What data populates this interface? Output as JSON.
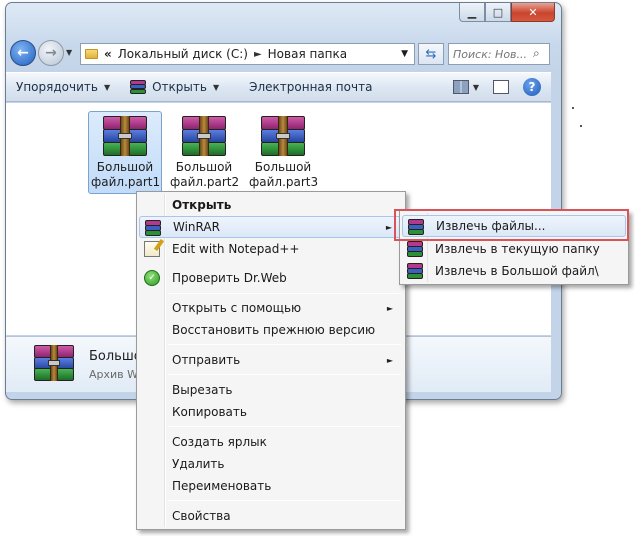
{
  "window": {
    "controls": {
      "minimize": "▁",
      "maximize": "□",
      "close": "✕"
    }
  },
  "address": {
    "prefix": "«",
    "crumbs": [
      "Локальный диск (C:)",
      "Новая папка"
    ],
    "separator": "►",
    "dropdown": "▼"
  },
  "search": {
    "placeholder": "Поиск: Нов..."
  },
  "toolbar": {
    "organize": "Упорядочить",
    "open": "Открыть",
    "email": "Электронная почта"
  },
  "files": [
    {
      "line1": "Большой",
      "line2": "файл.part1"
    },
    {
      "line1": "Большой",
      "line2": "файл.part2"
    },
    {
      "line1": "Большой",
      "line2": "файл.part3"
    }
  ],
  "status": {
    "name": "Большой",
    "type": "Архив W"
  },
  "context_menu": {
    "items": [
      "Открыть",
      "WinRAR",
      "Edit with Notepad++",
      "Проверить Dr.Web",
      "Открыть с помощью",
      "Восстановить прежнюю версию",
      "Отправить",
      "Вырезать",
      "Копировать",
      "Создать ярлык",
      "Удалить",
      "Переименовать",
      "Свойства"
    ]
  },
  "submenu": {
    "items": [
      "Извлечь файлы...",
      "Извлечь в текущую папку",
      "Извлечь в Большой файл\\"
    ]
  },
  "icons": {
    "rar_colors": [
      "#b23a8c",
      "#3d5fc1",
      "#2c8f3a"
    ],
    "names": [
      "back-arrow-icon",
      "forward-arrow-icon",
      "folder-icon",
      "refresh-icon",
      "search-icon",
      "winrar-icon",
      "notepad-icon",
      "drweb-icon",
      "help-icon"
    ]
  },
  "colors": {
    "accent": "#d9535a",
    "selection": "#c1dcf9"
  }
}
